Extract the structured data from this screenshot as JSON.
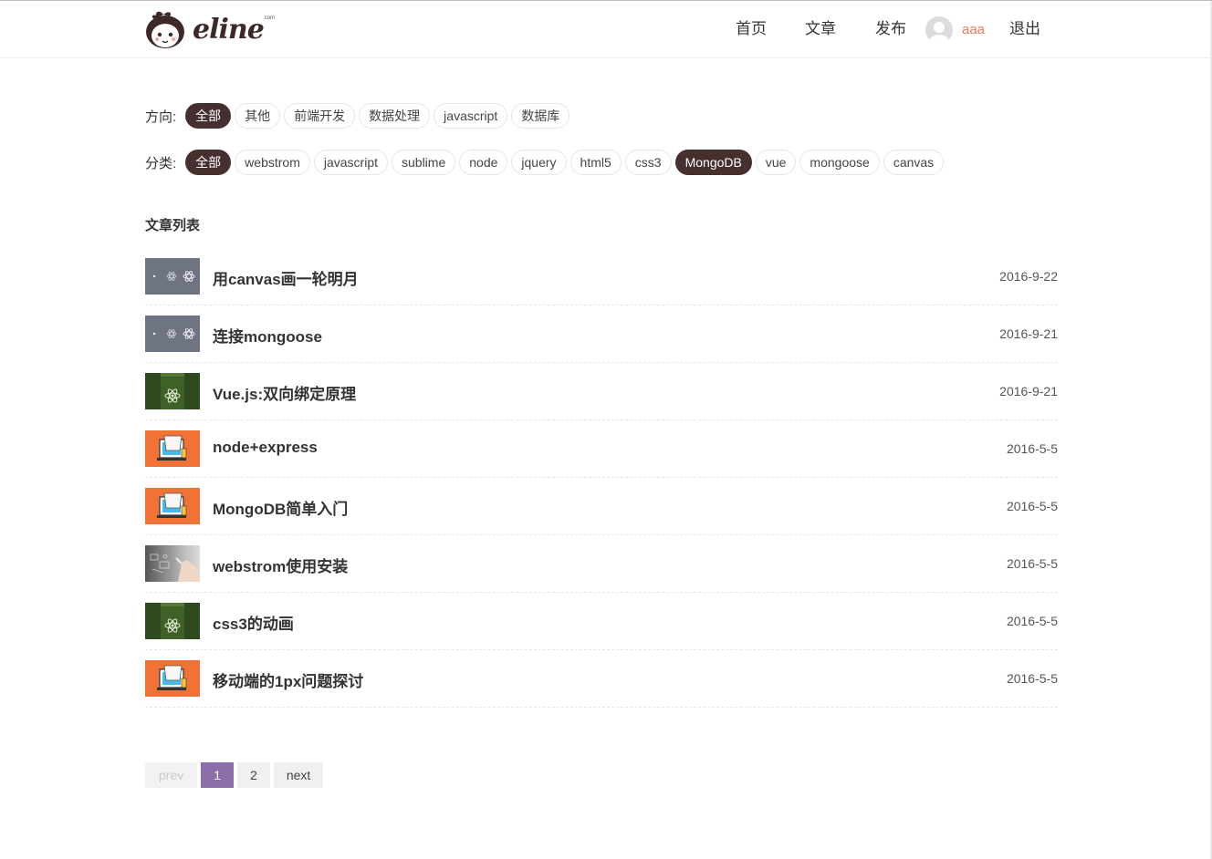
{
  "header": {
    "logo_text": "eline",
    "logo_sup": "com",
    "nav": [
      "首页",
      "文章",
      "发布"
    ],
    "username": "aaa",
    "logout": "退出"
  },
  "filters": {
    "direction_label": "方向:",
    "direction_tags": [
      "全部",
      "其他",
      "前端开发",
      "数据处理",
      "javascript",
      "数据库"
    ],
    "direction_active": "全部",
    "category_label": "分类:",
    "category_tags": [
      "全部",
      "webstrom",
      "javascript",
      "sublime",
      "node",
      "jquery",
      "html5",
      "css3",
      "MongoDB",
      "vue",
      "mongoose",
      "canvas"
    ],
    "category_active": [
      "全部",
      "MongoDB"
    ]
  },
  "list": {
    "title": "文章列表",
    "articles": [
      {
        "title": "用canvas画一轮明月",
        "date": "2016-9-22",
        "thumb": "grey"
      },
      {
        "title": "连接mongoose",
        "date": "2016-9-21",
        "thumb": "grey"
      },
      {
        "title": "Vue.js:双向绑定原理",
        "date": "2016-9-21",
        "thumb": "green"
      },
      {
        "title": "node+express",
        "date": "2016-5-5",
        "thumb": "orange"
      },
      {
        "title": "MongoDB简单入门",
        "date": "2016-5-5",
        "thumb": "orange"
      },
      {
        "title": "webstrom使用安装",
        "date": "2016-5-5",
        "thumb": "photo"
      },
      {
        "title": "css3的动画",
        "date": "2016-5-5",
        "thumb": "green"
      },
      {
        "title": "移动端的1px问题探讨",
        "date": "2016-5-5",
        "thumb": "orange"
      }
    ]
  },
  "pagination": {
    "prev": "prev",
    "pages": [
      "1",
      "2"
    ],
    "current": "1",
    "next": "next"
  },
  "colors": {
    "accent_dark": "#46302f",
    "username": "#e87a5d",
    "page_current": "#8b6ea8"
  }
}
